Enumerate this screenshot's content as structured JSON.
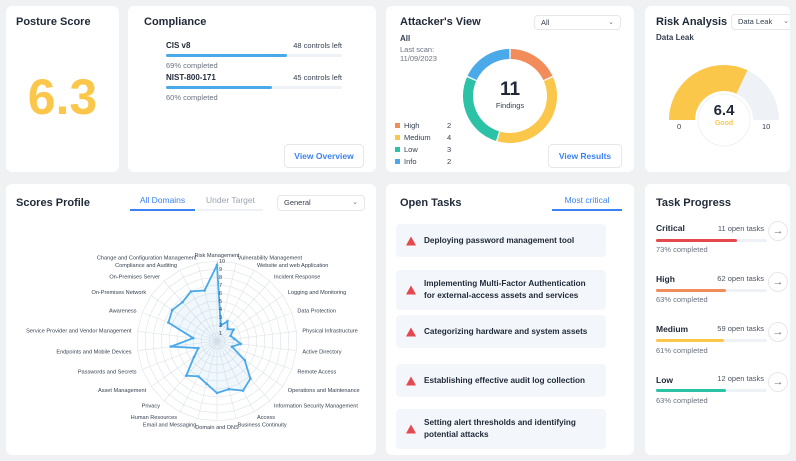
{
  "posture": {
    "title": "Posture Score",
    "score": "6.3"
  },
  "compliance": {
    "title": "Compliance",
    "items": [
      {
        "name": "CIS v8",
        "controls_left": "48 controls left",
        "completed_text": "69% completed",
        "progress": 0.69
      },
      {
        "name": "NIST-800-171",
        "controls_left": "45 controls left",
        "completed_text": "60% completed",
        "progress": 0.6
      }
    ],
    "button": "View Overview"
  },
  "attacker": {
    "title": "Attacker's View",
    "filter_value": "All",
    "subtitle": "All",
    "last_scan_label": "Last scan:",
    "last_scan_date": "11/09/2023",
    "findings_count": "11",
    "findings_label": "Findings",
    "legend": [
      {
        "label": "High",
        "count": "2",
        "color": "#f28c5b"
      },
      {
        "label": "Medium",
        "count": "4",
        "color": "#fbc74b"
      },
      {
        "label": "Low",
        "count": "3",
        "color": "#2bc2a6"
      },
      {
        "label": "Info",
        "count": "2",
        "color": "#4aa9e9"
      }
    ],
    "button": "View Results"
  },
  "risk": {
    "title": "Risk Analysis",
    "dropdown": "Data Leak",
    "subtitle": "Data Leak",
    "value": "6.4",
    "rating": "Good",
    "min": "0",
    "max": "10",
    "level": 0.64,
    "color": "#fbc74b"
  },
  "scores_profile": {
    "title": "Scores Profile",
    "tabs": [
      "All Domains",
      "Under Target"
    ],
    "select": "General",
    "ticks": [
      "10",
      "9",
      "8",
      "7",
      "6",
      "5",
      "4",
      "3",
      "2",
      "1"
    ],
    "domains": [
      {
        "label": "Risk Management",
        "value": 9.5
      },
      {
        "label": "Vulnerability Management",
        "value": 2.0
      },
      {
        "label": "Website and web Application",
        "value": 2.8
      },
      {
        "label": "Incident Response",
        "value": 2.0
      },
      {
        "label": "Logging and Monitoring",
        "value": 2.5
      },
      {
        "label": "Data Protection",
        "value": 1.8
      },
      {
        "label": "Physical Infrastructure",
        "value": 2.2
      },
      {
        "label": "Active Directory",
        "value": 3.0
      },
      {
        "label": "Remote Access",
        "value": 2.0
      },
      {
        "label": "Operations and Maintenance",
        "value": 4.2
      },
      {
        "label": "Information Security Management",
        "value": 6.3
      },
      {
        "label": "Access",
        "value": 7.0
      },
      {
        "label": "Business Continuity",
        "value": 6.2
      },
      {
        "label": "Domain and DNS",
        "value": 6.5
      },
      {
        "label": "Email and Messaging",
        "value": 5.5
      },
      {
        "label": "Human Resources",
        "value": 5.0
      },
      {
        "label": "Privacy",
        "value": 5.8
      },
      {
        "label": "Asset Management",
        "value": 3.5
      },
      {
        "label": "Passwords and Secrets",
        "value": 2.5
      },
      {
        "label": "Endpoints and Mobile Devices",
        "value": 5.8
      },
      {
        "label": "Service Provider and Vendor Management",
        "value": 3.0
      },
      {
        "label": "Awareness",
        "value": 6.5
      },
      {
        "label": "On-Premises Network",
        "value": 6.8
      },
      {
        "label": "On-Premises Server",
        "value": 6.5
      },
      {
        "label": "Compliance and Auditing",
        "value": 7.0
      },
      {
        "label": "Change and Configuration Management",
        "value": 6.5
      }
    ],
    "line_color": "#4aa9e9"
  },
  "open_tasks": {
    "title": "Open Tasks",
    "filter": "Most critical",
    "items": [
      "Deploying password management tool",
      "Implementing Multi-Factor Authentication for external-access assets and services",
      "Categorizing hardware and system assets",
      "Establishing effective audit log collection",
      "Setting alert thresholds and identifying potential attacks"
    ]
  },
  "task_progress": {
    "title": "Task Progress",
    "items": [
      {
        "label": "Critical",
        "open": "11 open tasks",
        "completed_text": "73% completed",
        "progress": 0.73,
        "color": "#e5484d"
      },
      {
        "label": "High",
        "open": "62 open tasks",
        "completed_text": "63% completed",
        "progress": 0.63,
        "color": "#f28c5b"
      },
      {
        "label": "Medium",
        "open": "59 open tasks",
        "completed_text": "61% completed",
        "progress": 0.61,
        "color": "#fbc74b"
      },
      {
        "label": "Low",
        "open": "12 open tasks",
        "completed_text": "63% completed",
        "progress": 0.63,
        "color": "#2bc2a6"
      }
    ]
  },
  "colors": {
    "accent": "#3b82f6",
    "score": "#fbc74b"
  }
}
